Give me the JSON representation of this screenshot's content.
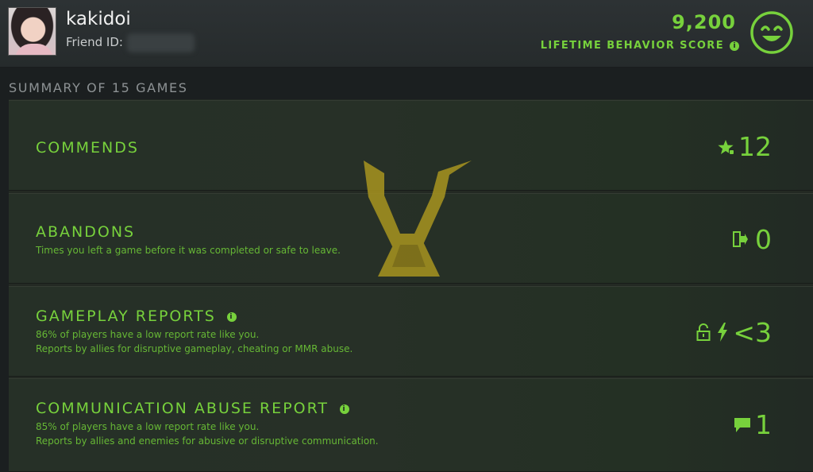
{
  "header": {
    "username": "kakidoi",
    "friend_id_label": "Friend ID:",
    "score": "9,200",
    "score_label": "LIFETIME BEHAVIOR SCORE",
    "score_info_glyph": "i",
    "smiley_icon": "smiley-face-icon"
  },
  "summary": {
    "title": "SUMMARY OF 15 GAMES",
    "rows": [
      {
        "title": "COMMENDS",
        "description_lines": [],
        "value": "12",
        "icon": "star-thumb-icon"
      },
      {
        "title": "ABANDONS",
        "description_lines": [
          "Times you left a game before it was completed or safe to leave."
        ],
        "value": "0",
        "icon": "exit-door-icon"
      },
      {
        "title": "GAMEPLAY REPORTS",
        "info_glyph": "i",
        "description_lines": [
          "86% of players have a low report rate like you.",
          "Reports by allies for disruptive gameplay, cheating or MMR abuse."
        ],
        "value": "<3",
        "icons": [
          "lock-icon",
          "lightning-icon"
        ]
      },
      {
        "title": "COMMUNICATION ABUSE REPORT",
        "info_glyph": "i",
        "description_lines": [
          "85% of players have a low report rate like you.",
          "Reports by allies and enemies for abusive or disruptive communication."
        ],
        "value": "1",
        "icon": "chat-bubble-icon"
      }
    ]
  },
  "colors": {
    "accent_green": "#77d13c",
    "logo_gold": "#a8941f"
  }
}
